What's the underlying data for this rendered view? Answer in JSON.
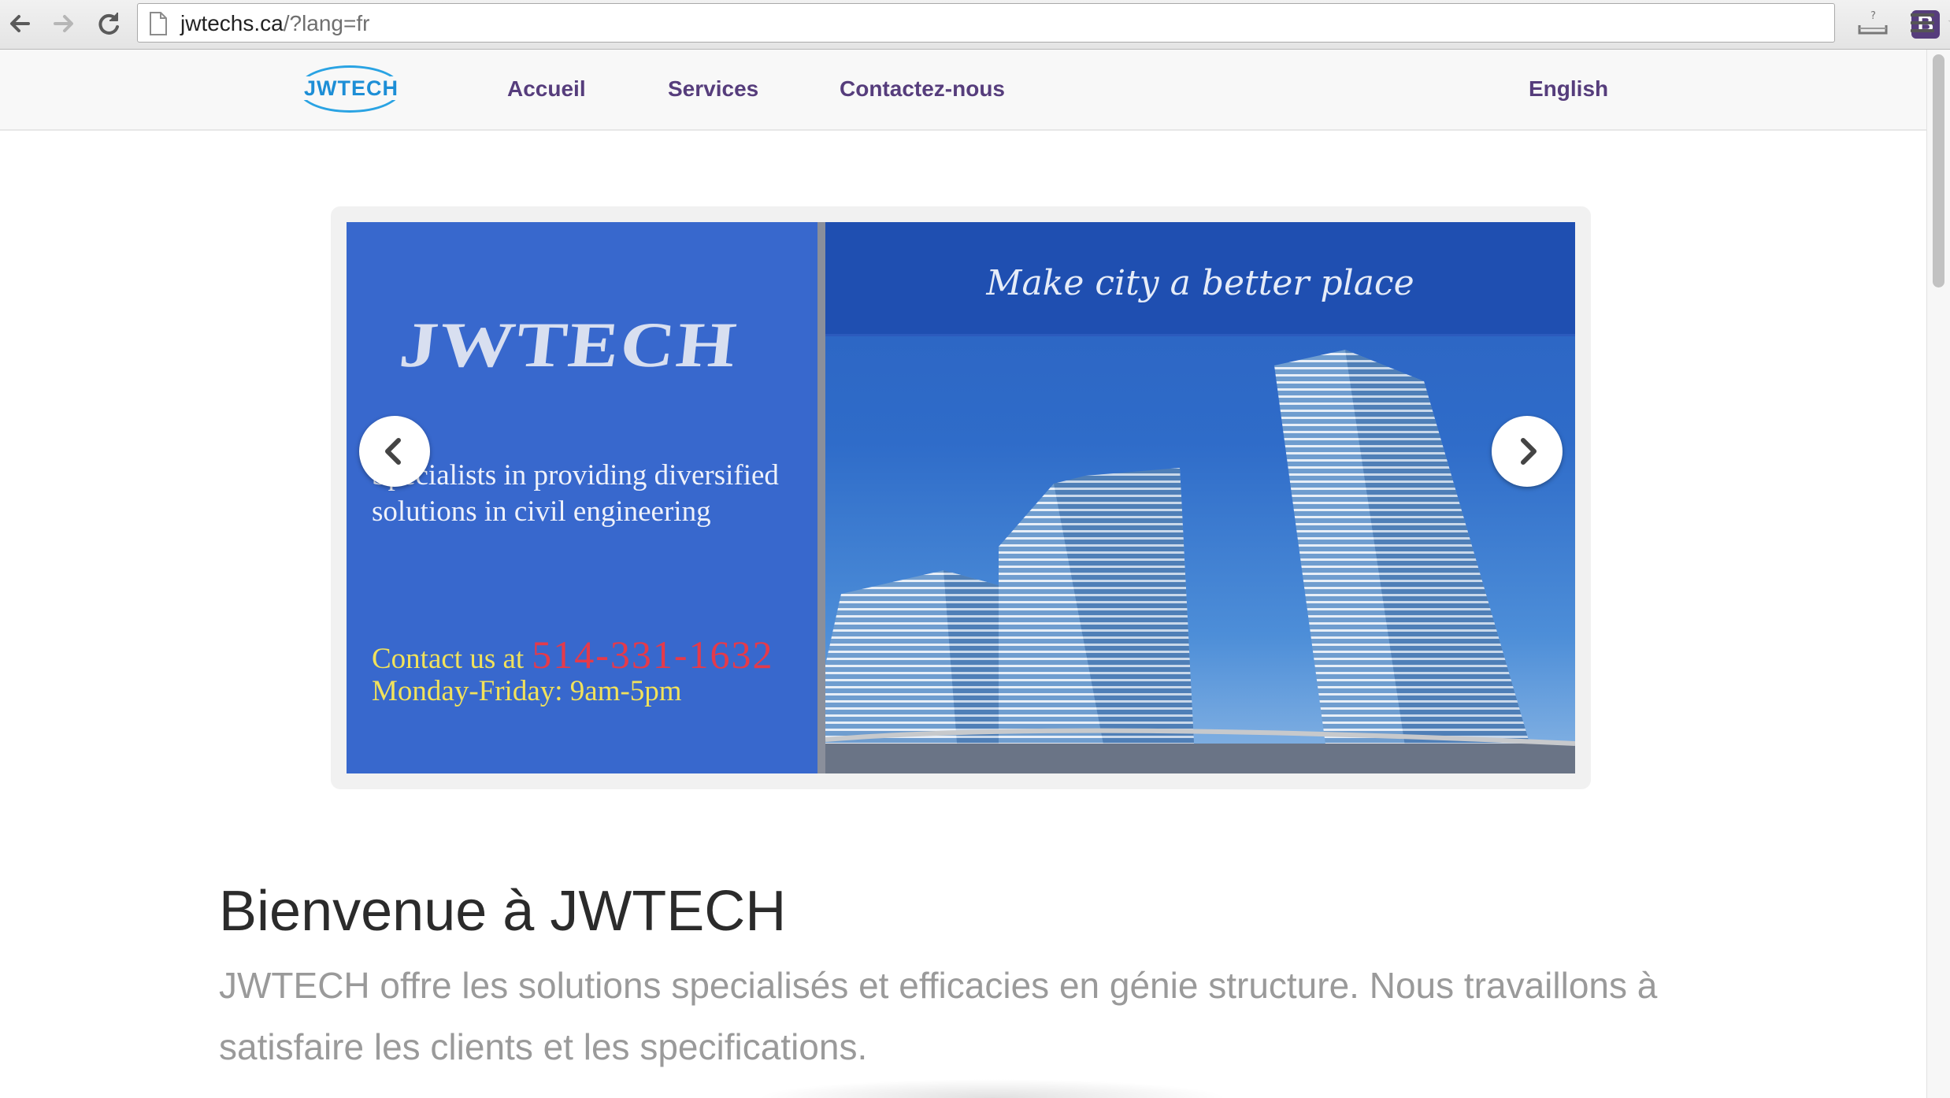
{
  "browser": {
    "url_host": "jwtechs.ca",
    "url_path": "/?lang=fr",
    "extension_label": "B",
    "icons": [
      "back-arrow-icon",
      "forward-arrow-icon",
      "reload-icon",
      "page-icon",
      "bootstrap-extension-icon",
      "bookmark-star-icon",
      "download-tray-icon",
      "hamburger-menu-icon"
    ]
  },
  "navbar": {
    "logo_text": "JWTECH",
    "links": [
      "Accueil",
      "Services",
      "Contactez-nous"
    ],
    "language_link": "English",
    "link_color": "#563d7c"
  },
  "carousel": {
    "tagline": "Make city a better place",
    "brand": "JWTECH",
    "description_line1": "Specialists in providing diversified",
    "description_line2": "solutions in civil engineering",
    "contact_prefix": "Contact us at",
    "phone": "514-331-1632",
    "hours": "Monday-Friday: 9am-5pm",
    "slide_color": "#3868cd"
  },
  "content": {
    "heading": "Bienvenue à JWTECH",
    "lead": "JWTECH offre les solutions specialisés et efficacies en génie structure. Nous travaillons à satisfaire les clients et les specifications."
  }
}
